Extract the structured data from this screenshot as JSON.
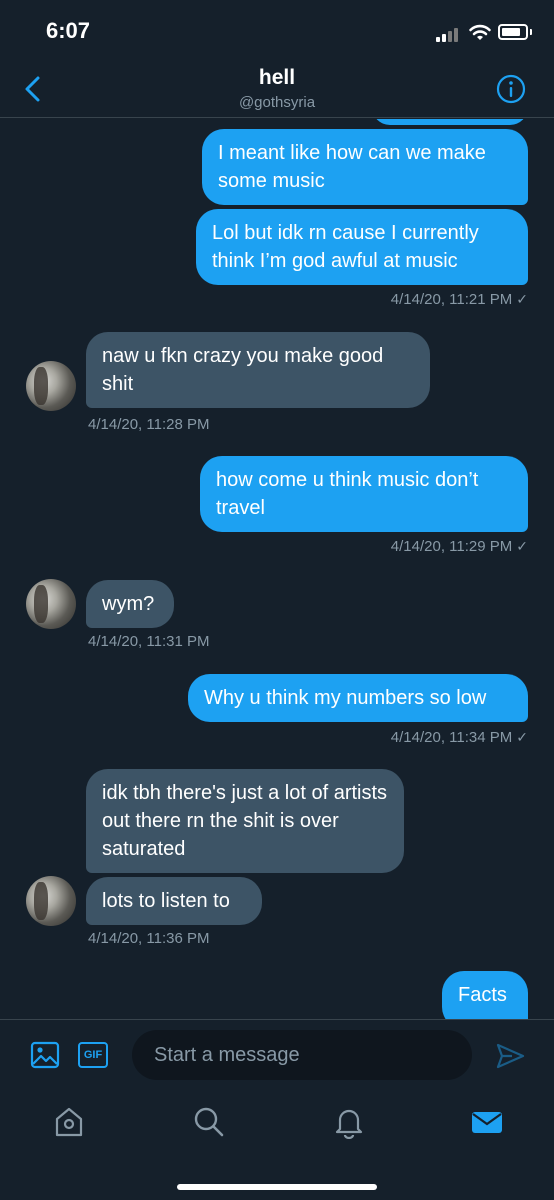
{
  "status_bar": {
    "time": "6:07",
    "battery_level": 0.8
  },
  "header": {
    "title": "hell",
    "handle": "@gothsyria",
    "back_icon": "chevron-left-icon",
    "info_icon": "info-icon"
  },
  "messages": [
    {
      "direction": "sent",
      "text": "I meant like how can we make some music"
    },
    {
      "direction": "sent",
      "text": "Lol but idk rn cause I currently think I’m god awful at music",
      "timestamp": "4/14/20, 11:21 PM"
    },
    {
      "direction": "received",
      "text": "naw u fkn crazy you make good shit",
      "timestamp": "4/14/20, 11:28 PM"
    },
    {
      "direction": "sent",
      "text": "how come u think music don’t travel",
      "timestamp": "4/14/20, 11:29 PM"
    },
    {
      "direction": "received",
      "text": "wym?",
      "timestamp": "4/14/20, 11:31 PM"
    },
    {
      "direction": "sent",
      "text": "Why u think my numbers so low",
      "timestamp": "4/14/20, 11:34 PM"
    },
    {
      "direction": "received",
      "text": "idk tbh there's just a lot of artists out there rn the shit is over saturated"
    },
    {
      "direction": "received",
      "text": "lots to listen to",
      "timestamp": "4/14/20, 11:36 PM"
    },
    {
      "direction": "sent",
      "text": "Facts"
    }
  ],
  "read_check": "✓",
  "composer": {
    "placeholder": "Start a message",
    "gif_label": "GIF",
    "media_icon": "image-icon",
    "send_icon": "send-icon"
  },
  "tabbar": {
    "items": [
      "home-icon",
      "search-icon",
      "bell-icon",
      "mail-icon"
    ],
    "active": "mail-icon"
  },
  "colors": {
    "background": "#15202b",
    "accent": "#1da1f2",
    "received_bubble": "#3d5466",
    "secondary_text": "#8899a6"
  }
}
